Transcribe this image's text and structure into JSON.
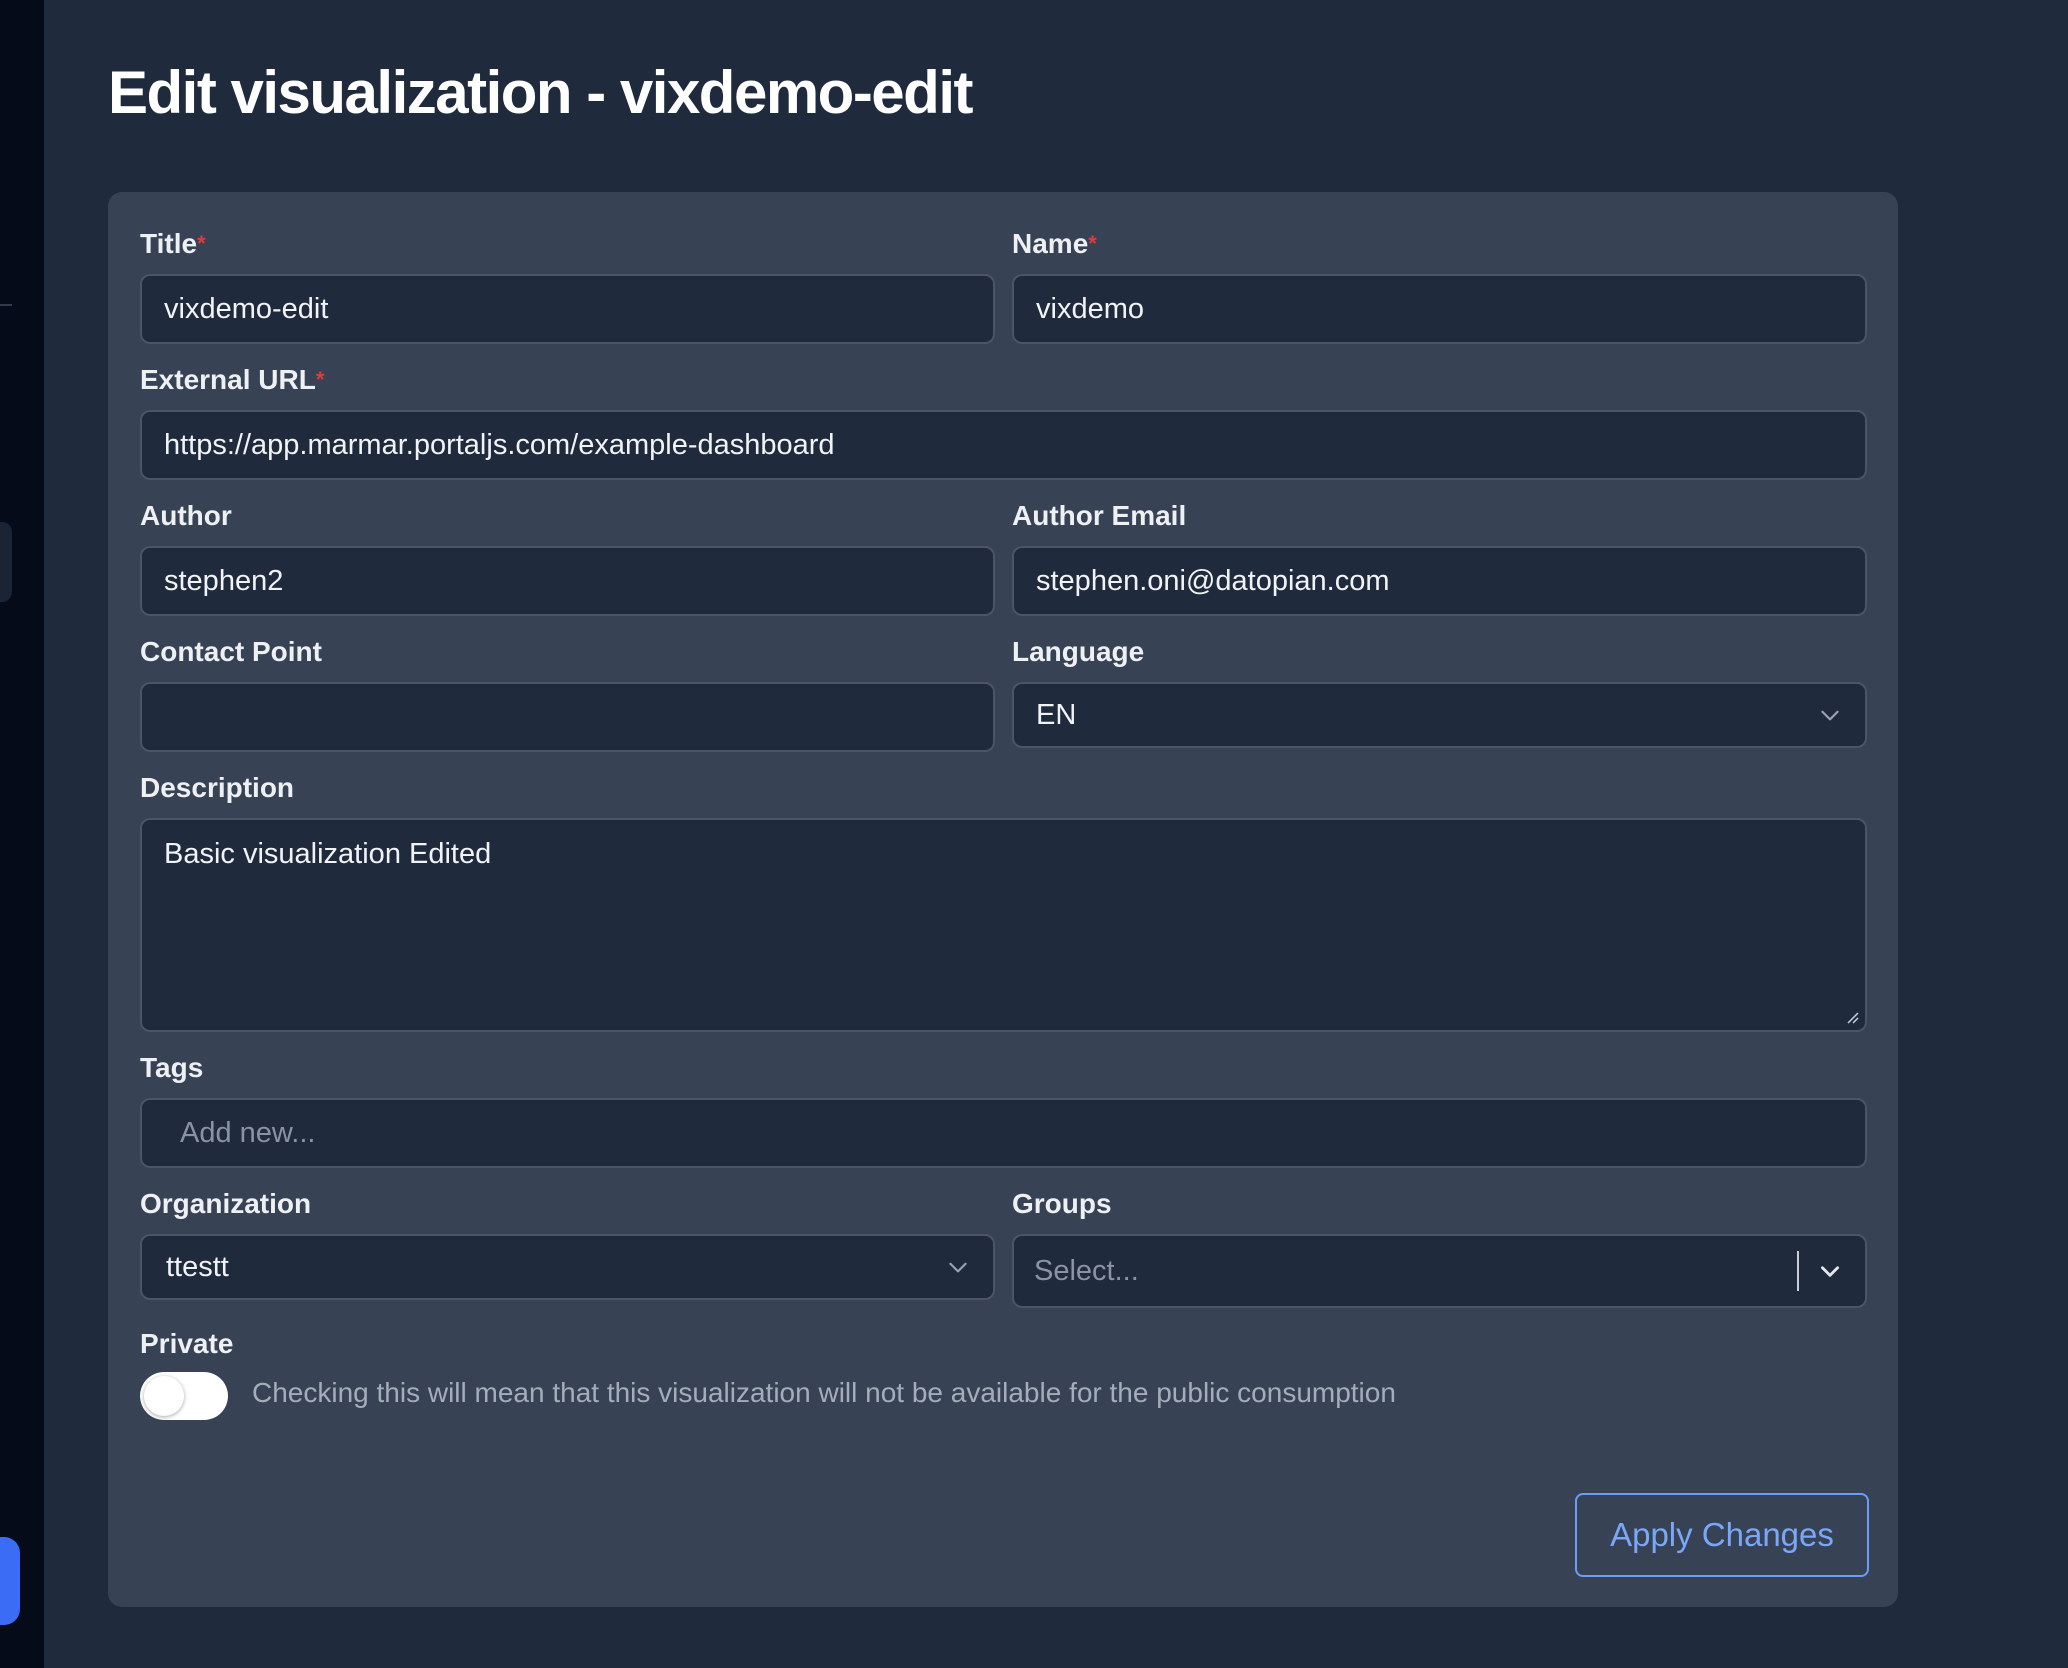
{
  "page": {
    "title": "Edit visualization - vixdemo-edit"
  },
  "form": {
    "title": {
      "label": "Title",
      "required_mark": "*",
      "value": "vixdemo-edit"
    },
    "name": {
      "label": "Name",
      "required_mark": "*",
      "value": "vixdemo"
    },
    "external_url": {
      "label": "External URL",
      "required_mark": "*",
      "value": "https://app.marmar.portaljs.com/example-dashboard"
    },
    "author": {
      "label": "Author",
      "value": "stephen2"
    },
    "author_email": {
      "label": "Author Email",
      "value": "stephen.oni@datopian.com"
    },
    "contact_point": {
      "label": "Contact Point",
      "value": ""
    },
    "language": {
      "label": "Language",
      "value": "EN"
    },
    "description": {
      "label": "Description",
      "value": "Basic visualization Edited"
    },
    "tags": {
      "label": "Tags",
      "placeholder": "Add new..."
    },
    "organization": {
      "label": "Organization",
      "value": "ttestt"
    },
    "groups": {
      "label": "Groups",
      "placeholder": "Select..."
    },
    "private": {
      "label": "Private",
      "checked": false,
      "hint": "Checking this will mean that this visualization will not be available for the public consumption"
    },
    "apply_button": "Apply Changes"
  },
  "colors": {
    "background": "#1f2a3c",
    "card": "#374254",
    "accent": "#7aa7f8",
    "required": "#e03b3b"
  },
  "icons": [
    "chevron-down-icon",
    "resize-grip-icon"
  ]
}
